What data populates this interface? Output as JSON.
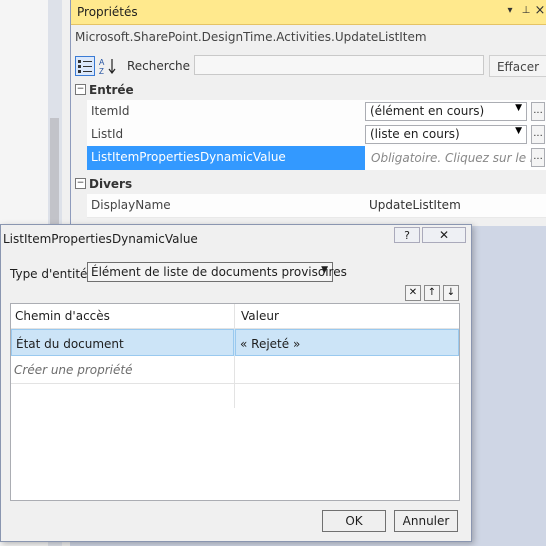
{
  "properties_panel": {
    "title": "Propriétés",
    "pin_symbol": "▾",
    "pin_glyph": "⊥",
    "close_symbol": "×",
    "subject": "Microsoft.SharePoint.DesignTime.Activities.UpdateListItem",
    "search_label": "Recherche :",
    "search_placeholder": "",
    "clear_label": "Effacer",
    "sort_icon_text": "A Z",
    "categories": [
      {
        "name": "Entrée",
        "toggle": "⊟"
      },
      {
        "name": "Divers",
        "toggle": "⊟"
      }
    ],
    "rows": [
      {
        "name": "ItemId",
        "value": "(élément en cours)"
      },
      {
        "name": "ListId",
        "value": "(liste en cours)"
      },
      {
        "name": "ListItemPropertiesDynamicValue",
        "value": "Obligatoire. Cliquez sur le bou"
      },
      {
        "name": "DisplayName",
        "value": "UpdateListItem"
      }
    ],
    "ellipsis": "..."
  },
  "dialog": {
    "title": "ListItemPropertiesDynamicValue",
    "help": "?",
    "close": "✕",
    "entity_type_label": "Type d'entité",
    "entity_type_value": "Élément de liste de documents provisoires",
    "grid_buttons": [
      "✕",
      "↑",
      "↓"
    ],
    "columns": [
      "Chemin d'accès",
      "Valeur"
    ],
    "rows": [
      {
        "path": "État du document",
        "value": "« Rejeté »"
      }
    ],
    "new_row_placeholder": "Créer une propriété",
    "ok_label": "OK",
    "cancel_label": "Annuler"
  },
  "colors": {
    "titlebar": "#ffe98d",
    "selection": "#3399ff",
    "grid_selection": "#cce4f7"
  }
}
